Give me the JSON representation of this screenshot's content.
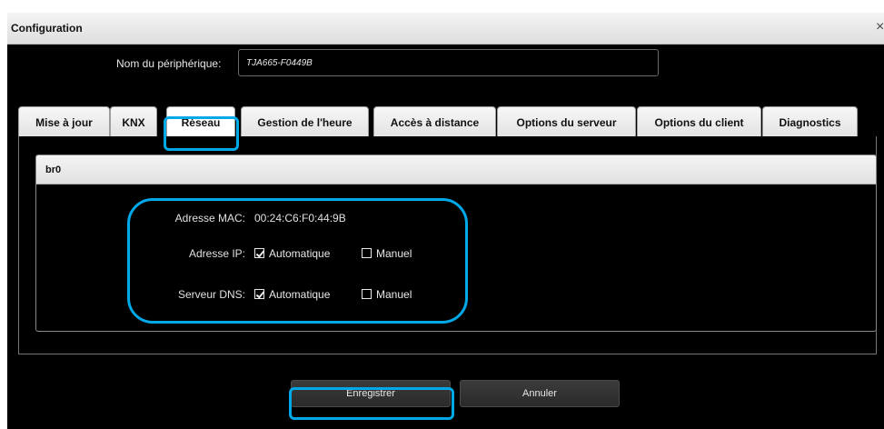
{
  "dialog": {
    "title": "Configuration",
    "close_glyph": "×"
  },
  "device": {
    "name_label": "Nom du périphérique:",
    "name_value": "TJA665-F0449B"
  },
  "tabs": [
    {
      "label": "Mise à jour"
    },
    {
      "label": "KNX"
    },
    {
      "label": "Réseau",
      "active": true
    },
    {
      "label": "Gestion de l'heure"
    },
    {
      "label": "Accès à distance"
    },
    {
      "label": "Options du serveur"
    },
    {
      "label": "Options du client"
    },
    {
      "label": "Diagnostics"
    }
  ],
  "interface": {
    "title": "br0",
    "mac_label": "Adresse MAC:",
    "mac_value": "00:24:C6:F0:44:9B",
    "ip": {
      "label": "Adresse IP:",
      "auto_label": "Automatique",
      "auto_checked": true,
      "manual_label": "Manuel",
      "manual_checked": false
    },
    "dns": {
      "label": "Serveur DNS:",
      "auto_label": "Automatique",
      "auto_checked": true,
      "manual_label": "Manuel",
      "manual_checked": false
    }
  },
  "buttons": {
    "save": "Enregistrer",
    "cancel": "Annuler"
  },
  "colors": {
    "highlight": "#00a8e8",
    "background": "#000000"
  },
  "icons": {
    "close": "close-icon",
    "checkbox_checked": "checkbox-checked-icon",
    "checkbox_unchecked": "checkbox-unchecked-icon"
  }
}
